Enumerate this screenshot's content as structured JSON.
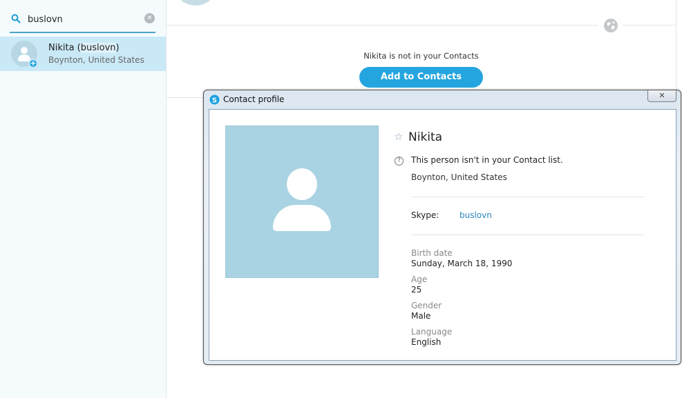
{
  "search": {
    "value": "buslovn"
  },
  "result": {
    "name_prefix": "Nikita (",
    "name_highlight": "buslovn",
    "name_suffix": ")",
    "location": "Boynton, United States"
  },
  "main": {
    "not_in_contacts": "Nikita is not in your Contacts",
    "add_button": "Add to Contacts"
  },
  "dialog": {
    "title": "Contact profile",
    "close_label": "✕",
    "name": "Nikita",
    "not_in_list": "This person isn't in your Contact list.",
    "location": "Boynton, United States",
    "skype_label": "Skype:",
    "skype_value": "buslovn",
    "fields": [
      {
        "label": "Birth date",
        "value": "Sunday, March 18, 1990"
      },
      {
        "label": "Age",
        "value": "25"
      },
      {
        "label": "Gender",
        "value": "Male"
      },
      {
        "label": "Language",
        "value": "English"
      }
    ]
  },
  "colors": {
    "accent": "#25a5df",
    "selection": "#c9e9f6",
    "link": "#2c86c0"
  },
  "icons": {
    "search": "search-icon",
    "clear": "clear-icon",
    "globe": "globe-icon",
    "skype": "skype-icon",
    "star": "star-icon",
    "help": "question-icon"
  }
}
